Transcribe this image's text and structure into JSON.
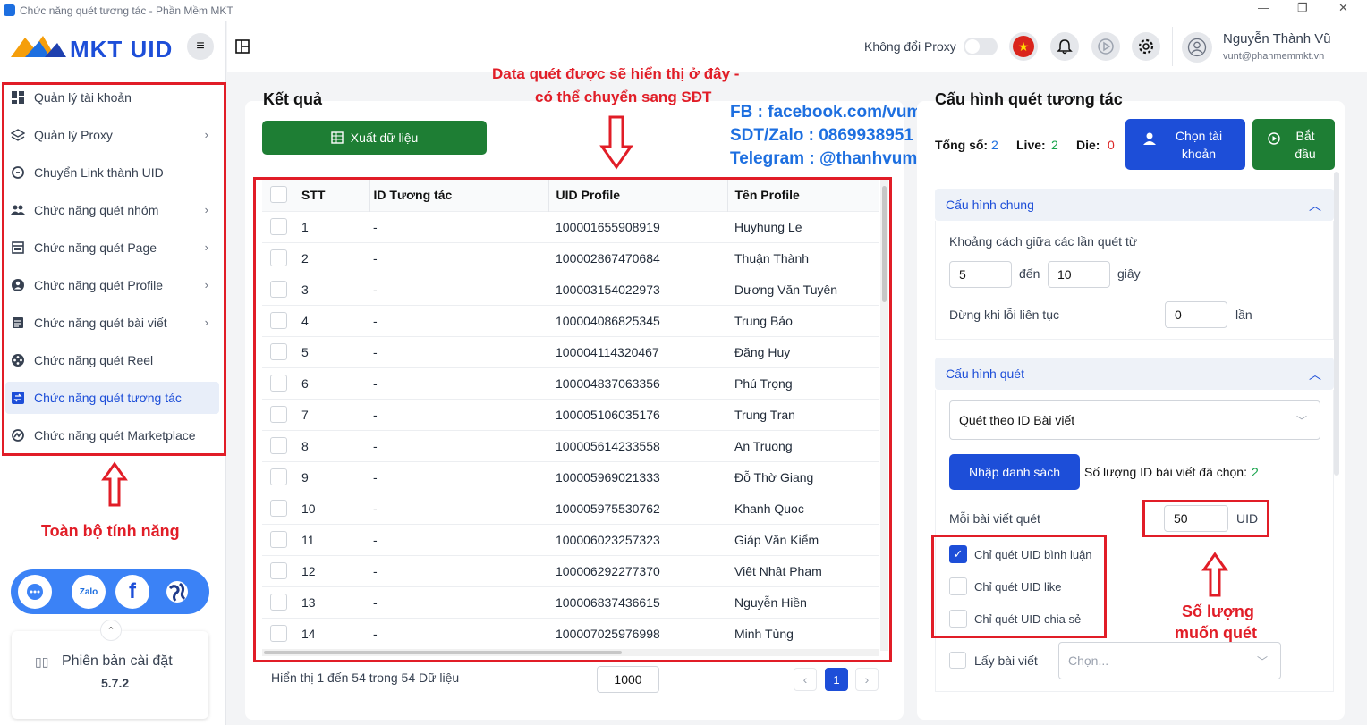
{
  "window": {
    "title": "Chức năng quét tương tác - Phần Mềm MKT"
  },
  "sidebar": {
    "logo_text": "MKT UID",
    "items": [
      {
        "label": "Quản lý tài khoản",
        "icon": "dashboard-icon",
        "chevron": false,
        "active": false
      },
      {
        "label": "Quản lý Proxy",
        "icon": "layers-icon",
        "chevron": true,
        "active": false
      },
      {
        "label": "Chuyển Link thành UID",
        "icon": "sync-icon",
        "chevron": false,
        "active": false
      },
      {
        "label": "Chức năng quét nhóm",
        "icon": "group-icon",
        "chevron": true,
        "active": false
      },
      {
        "label": "Chức năng quét Page",
        "icon": "page-icon",
        "chevron": true,
        "active": false
      },
      {
        "label": "Chức năng quét Profile",
        "icon": "user-circle-icon",
        "chevron": true,
        "active": false
      },
      {
        "label": "Chức năng quét bài viết",
        "icon": "article-icon",
        "chevron": true,
        "active": false
      },
      {
        "label": "Chức năng quét Reel",
        "icon": "reel-icon",
        "chevron": false,
        "active": false
      },
      {
        "label": "Chức năng quét tương tác",
        "icon": "interaction-icon",
        "chevron": false,
        "active": true
      },
      {
        "label": "Chức năng quét Marketplace",
        "icon": "marketplace-icon",
        "chevron": false,
        "active": false
      }
    ],
    "social": [
      "support-icon",
      "zalo-icon",
      "facebook-icon",
      "globe-icon"
    ],
    "zalo_text": "Zalo",
    "version_label": "Phiên bản cài đặt",
    "version": "5.7.2"
  },
  "topbar": {
    "proxy_label": "Không đổi Proxy",
    "proxy_on": false,
    "user_name": "Nguyễn Thành Vũ",
    "user_email": "vunt@phanmemmkt.vn"
  },
  "annotations": {
    "data_note_line1": "Data quét được sẽ hiển thị ở đây -",
    "data_note_line2": "có thể chuyển sang SĐT",
    "fb": "FB : facebook.com/vumkt",
    "sdt": "SDT/Zalo : 0869938951",
    "telegram": "Telegram : @thanhvumkt",
    "all_features": "Toàn bộ tính năng",
    "quantity_line1": "Số lượng",
    "quantity_line2": "muốn quét"
  },
  "results": {
    "title": "Kết quả",
    "export_label": "Xuất dữ liệu",
    "columns": [
      "STT",
      "ID Tương tác",
      "UID Profile",
      "Tên Profile"
    ],
    "rows": [
      [
        "1",
        "-",
        "100001655908919",
        "Huyhung Le"
      ],
      [
        "2",
        "-",
        "100002867470684",
        "Thuận Thành"
      ],
      [
        "3",
        "-",
        "100003154022973",
        "Dương Văn Tuyên"
      ],
      [
        "4",
        "-",
        "100004086825345",
        "Trung Bảo"
      ],
      [
        "5",
        "-",
        "100004114320467",
        "Đặng Huy"
      ],
      [
        "6",
        "-",
        "100004837063356",
        "Phú Trọng"
      ],
      [
        "7",
        "-",
        "100005106035176",
        "Trung Tran"
      ],
      [
        "8",
        "-",
        "100005614233558",
        "An Truong"
      ],
      [
        "9",
        "-",
        "100005969021333",
        "Đỗ Thờ Giang"
      ],
      [
        "10",
        "-",
        "100005975530762",
        "Khanh Quoc"
      ],
      [
        "11",
        "-",
        "100006023257323",
        "Giáp Văn Kiểm"
      ],
      [
        "12",
        "-",
        "100006292277370",
        "Việt Nhật Phạm"
      ],
      [
        "13",
        "-",
        "100006837436615",
        "Nguyễn Hiền"
      ],
      [
        "14",
        "-",
        "100007025976998",
        "Minh Tùng"
      ]
    ],
    "footer_text": "Hiển thị 1 đến 54 trong 54 Dữ liệu",
    "page_size": "1000",
    "page_prev": "‹",
    "current_page": "1",
    "page_next": "›"
  },
  "config": {
    "title": "Cấu hình quét tương tác",
    "total_label": "Tổng số:",
    "total": "2",
    "live_label": "Live:",
    "live": "2",
    "die_label": "Die:",
    "die": "0",
    "choose_account_label": "Chọn tài khoản",
    "start_label": "Bắt đầu",
    "general_title": "Cấu hình chung",
    "interval_label": "Khoảng cách giữa các lần quét từ",
    "interval_from": "5",
    "to_label": "đến",
    "interval_to": "10",
    "seconds_label": "giây",
    "stop_label": "Dừng khi lỗi liên tục",
    "stop_value": "0",
    "times_label": "lần",
    "scan_title": "Cấu hình quét",
    "scan_mode": "Quét theo ID Bài viết",
    "import_label": "Nhập danh sách",
    "selected_label": "Số lượng ID bài viết đã chọn:",
    "selected_count": "2",
    "per_post_label": "Mỗi bài viết quét",
    "per_post_value": "50",
    "uid_label": "UID",
    "options": [
      {
        "label": "Chỉ quét UID bình luận",
        "checked": true
      },
      {
        "label": "Chỉ quét UID like",
        "checked": false
      },
      {
        "label": "Chỉ quét UID chia sẻ",
        "checked": false
      }
    ],
    "get_posts_label": "Lấy bài viết",
    "get_posts_placeholder": "Chọn..."
  }
}
